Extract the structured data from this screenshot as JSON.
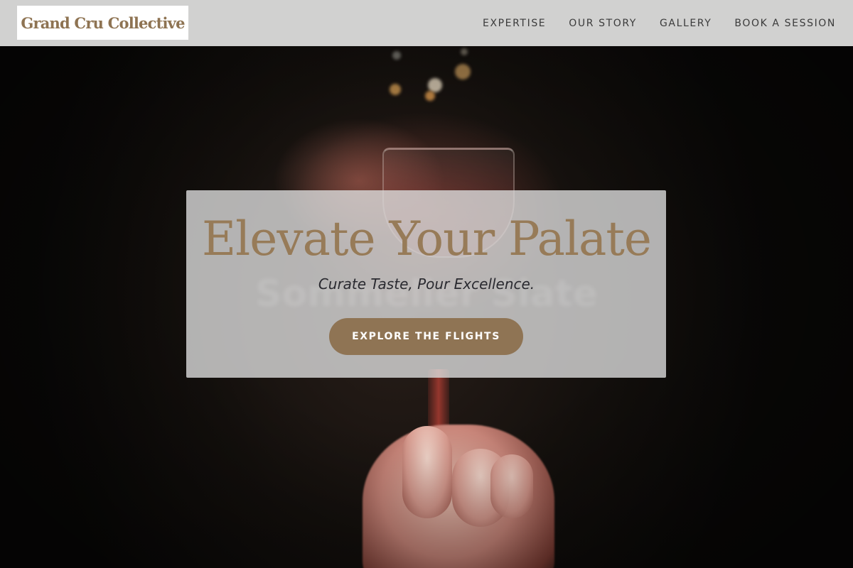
{
  "brand": {
    "name": "Grand Cru Collective",
    "color": "#8e7352"
  },
  "nav": {
    "items": [
      {
        "label": "EXPERTISE"
      },
      {
        "label": "OUR STORY"
      },
      {
        "label": "GALLERY"
      },
      {
        "label": "BOOK A SESSION"
      }
    ]
  },
  "hero": {
    "heading": "Elevate Your Palate",
    "tagline": "Curate Taste, Pour Excellence.",
    "background_text": "Sommelier Slate",
    "cta_label": "EXPLORE THE FLIGHTS",
    "accent_color": "#977b58",
    "background_image": "wine-glass-in-hand-photo"
  },
  "colors": {
    "header_bg": "#dededd",
    "button_bg": "#8f7454",
    "button_text": "#ffffff",
    "nav_text": "#3b3b3b"
  }
}
